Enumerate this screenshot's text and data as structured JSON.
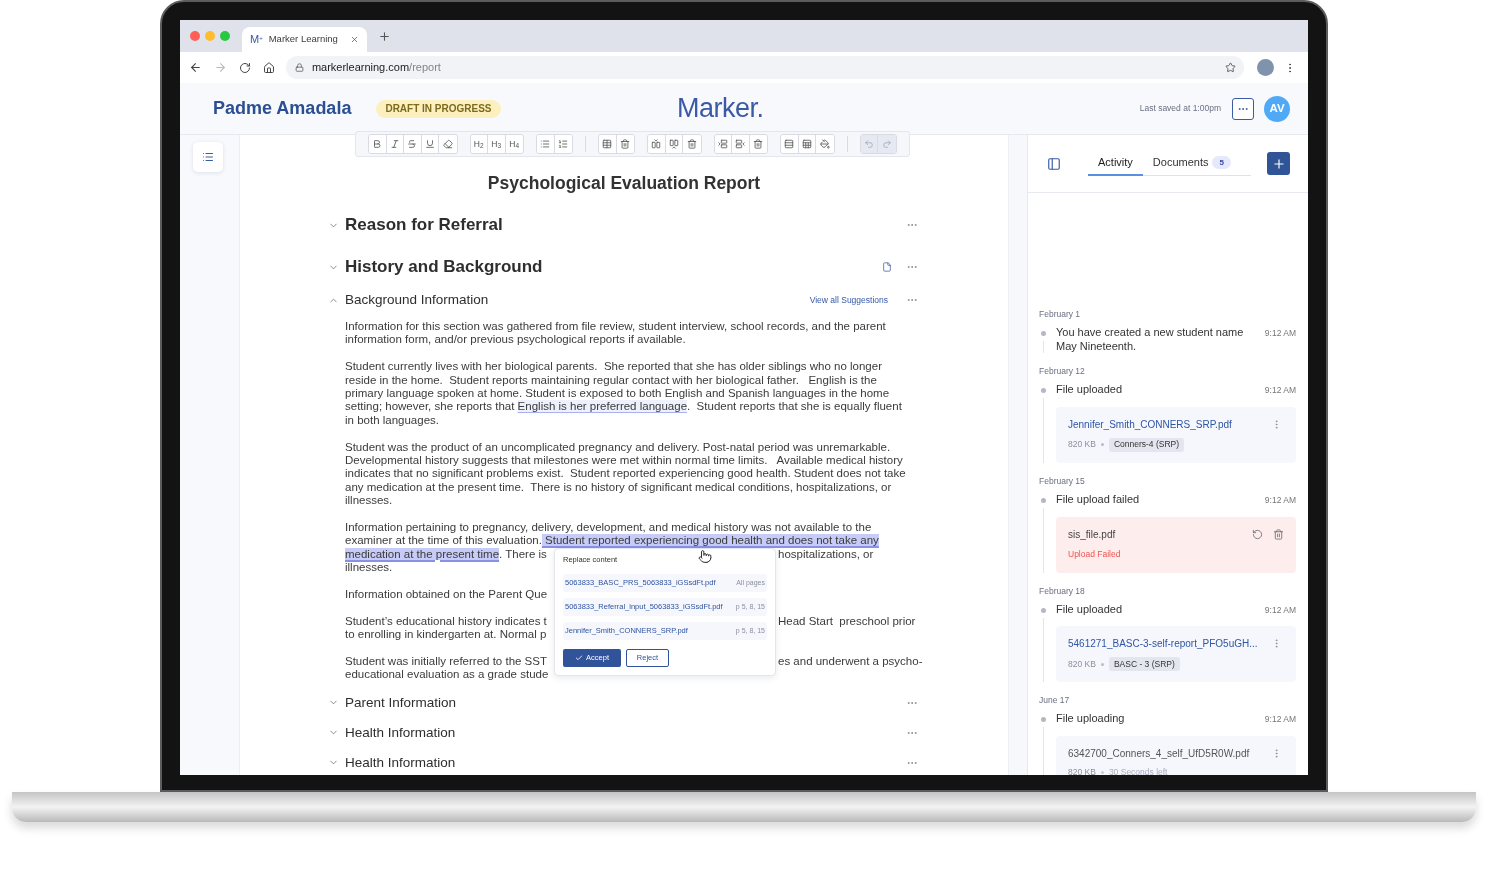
{
  "browser": {
    "nav": {
      "back": {
        "disabled": false
      },
      "forward": {
        "disabled": true
      }
    },
    "tab": {
      "favicon": "M$^{+}$",
      "title": "Marker Learning"
    },
    "url": {
      "host": "markerlearning.com",
      "path": "/report"
    }
  },
  "header": {
    "student_name": "Padme Amadala",
    "status_badge": "DRAFT IN PROGRESS",
    "logo": "Marker.",
    "last_saved": "Last saved at 1:00pm",
    "user_initials": "AV"
  },
  "toolbar": {
    "headings": [
      "H$_{2}$",
      "H$_{3}$",
      "H$_{4}$"
    ],
    "undo": {
      "disabled": true
    },
    "redo": {
      "disabled": true
    }
  },
  "document": {
    "title": "Psychological Evaluation Report",
    "sections": [
      {
        "title": "Reason for Referral",
        "expanded": false
      },
      {
        "title": "History and Background",
        "expanded": false,
        "document_icon": true,
        "children": [
          {
            "title": "Background Information",
            "expanded": true,
            "link": "View all Suggestions",
            "paragraphs": [
              {
                "lines": [
                  {
                    "text": "Information for this section was gathered from file review, student interview, school records, and the parent"
                  },
                  {
                    "text": "information form, and/or previous psychological reports if available."
                  }
                ]
              },
              {
                "lines": [
                  {
                    "text": "Student currently lives with her biological parents.  She reported that she has older siblings who no longer"
                  },
                  {
                    "text": "reside in the home.  Student reports maintaining regular contact with her biological father.   English is the"
                  },
                  {
                    "text": "primary language spoken at home. Student is exposed to both English and Spanish languages in the home"
                  },
                  {
                    "segments": [
                      {
                        "text": "setting; however, she reports that ",
                        "kind": "plain"
                      },
                      {
                        "text": "English is her preferred language",
                        "kind": "suggestion"
                      },
                      {
                        "text": ".  Student reports that she is equally fluent",
                        "kind": "plain"
                      }
                    ]
                  },
                  {
                    "text": "in both languages."
                  }
                ]
              },
              {
                "lines": [
                  {
                    "text": "Student was the product of an uncomplicated pregnancy and delivery. Post-natal period was unremarkable."
                  },
                  {
                    "text": "Developmental history suggests that milestones were met within normal time limits.   Available medical history"
                  },
                  {
                    "text": "indicates that no significant problems exist.  Student reported experiencing good health. Student does not take"
                  },
                  {
                    "text": "any medication at the present time.  There is no history of significant medical conditions, hospitalizations, or"
                  },
                  {
                    "text": "illnesses."
                  }
                ]
              },
              {
                "lines": [
                  {
                    "text": "Information pertaining to pregnancy, delivery, development, and medical history was not available to the"
                  },
                  {
                    "segments": [
                      {
                        "text": "examiner at the time of this evaluation.",
                        "kind": "plain"
                      },
                      {
                        "text": " Student reported experiencing good health and does not take any",
                        "kind": "selected"
                      }
                    ]
                  },
                  {
                    "segments": [
                      {
                        "text": "medication at the present time",
                        "kind": "selected"
                      },
                      {
                        "text": ". There is",
                        "kind": "plain"
                      }
                    ],
                    "after_popup": "hospitalizations, or"
                  },
                  {
                    "text": "illnesses."
                  }
                ]
              },
              {
                "lines": [
                  {
                    "text": "Information obtained on the Parent Que"
                  }
                ]
              },
              {
                "lines": [
                  {
                    "text": "Student’s educational history indicates t",
                    "after_popup": "Head Start  preschool prior"
                  },
                  {
                    "text": "to enrolling in kindergarten at. Normal p"
                  }
                ]
              },
              {
                "lines": [
                  {
                    "text": "Student was initially referred to the SST",
                    "after_popup": "es and underwent a psycho-"
                  },
                  {
                    "text": "educational evaluation as a grade stude"
                  }
                ]
              }
            ]
          },
          {
            "title": "Parent Information",
            "expanded": false
          },
          {
            "title": "Health Information",
            "expanded": false
          },
          {
            "title": "Health Information",
            "expanded": false
          }
        ]
      }
    ]
  },
  "suggestion_popup": {
    "title": "Replace content",
    "sources": [
      {
        "name": "5063833_BASC_PRS_5063833_iGSsdFt.pdf",
        "pages": "All pages"
      },
      {
        "name": "5063833_Referral_input_5063833_iGSsdFt.pdf",
        "pages": "p 5, 8, 15"
      },
      {
        "name": "Jennifer_Smith_CONNERS_SRP.pdf",
        "pages": "p 5, 8, 15"
      }
    ],
    "accept": "Accept",
    "reject": "Reject"
  },
  "side_panel": {
    "tabs": [
      {
        "label": "Activity",
        "selected": true
      },
      {
        "label": "Documents",
        "selected": false,
        "count": "5"
      }
    ],
    "activity": [
      {
        "date": "February 1",
        "text": "You have created a new student name May Nineteenth.",
        "time": "9:12 AM"
      },
      {
        "date": "February 12",
        "text": "File uploaded",
        "time": "9:12 AM",
        "file": {
          "kind": "uploaded",
          "name": "Jennifer_Smith_CONNERS_SRP.pdf",
          "size": "820 KB",
          "tag": "Conners-4 (SRP)"
        }
      },
      {
        "date": "February 15",
        "text": "File upload failed",
        "time": "9:12 AM",
        "file": {
          "kind": "failed",
          "name": "sis_file.pdf",
          "error": "Upload Failed"
        }
      },
      {
        "date": "February 18",
        "text": "File uploaded",
        "time": "9:12 AM",
        "file": {
          "kind": "uploaded",
          "name": "5461271_BASC-3-self-report_PFO5uGH...",
          "size": "820 KB",
          "tag": "BASC - 3 (SRP)"
        }
      },
      {
        "date": "June 17",
        "text": "File uploading",
        "time": "9:12 AM",
        "file": {
          "kind": "uploading",
          "name": "6342700_Conners_4_self_UfD5R0W.pdf",
          "size": "820 KB",
          "progress": "30 Seconds left"
        }
      }
    ]
  }
}
